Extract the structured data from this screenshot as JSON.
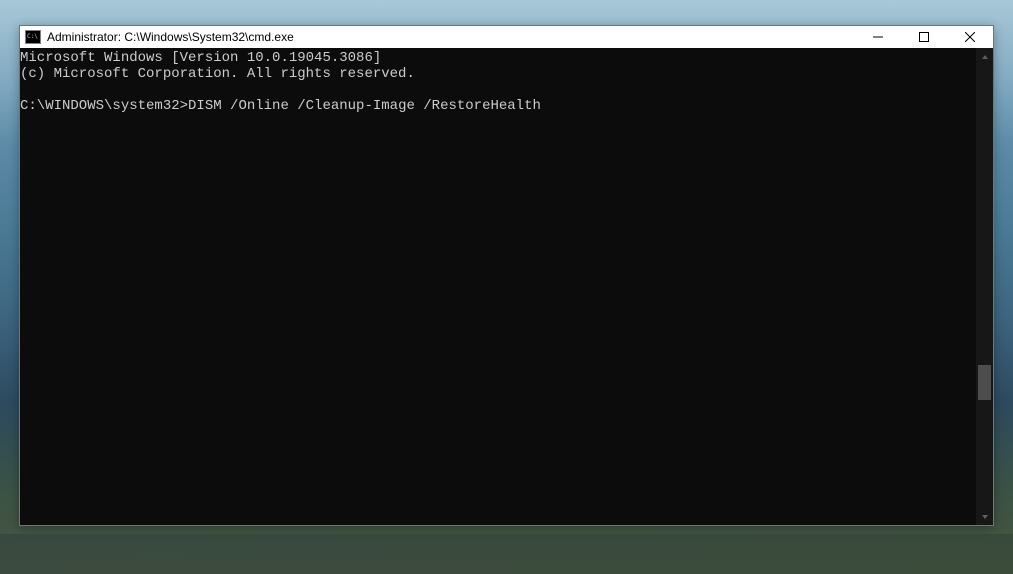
{
  "window": {
    "title": "Administrator: C:\\Windows\\System32\\cmd.exe"
  },
  "terminal": {
    "line1": "Microsoft Windows [Version 10.0.19045.3086]",
    "line2": "(c) Microsoft Corporation. All rights reserved.",
    "prompt": "C:\\WINDOWS\\system32>",
    "command": "DISM /Online /Cleanup-Image /RestoreHealth"
  }
}
